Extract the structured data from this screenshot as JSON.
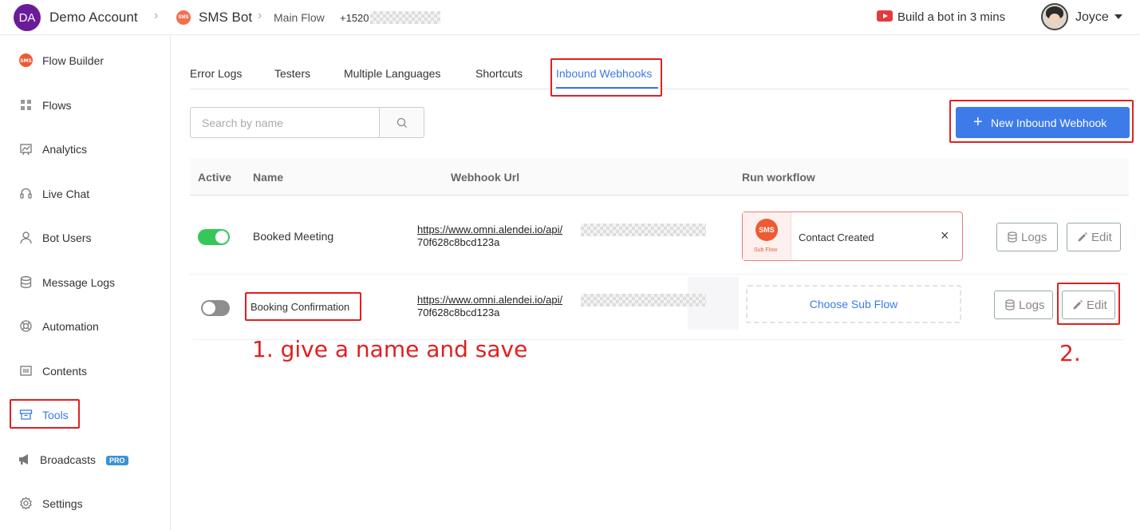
{
  "header": {
    "account_initials": "DA",
    "account_name": "Demo Account",
    "bot_badge": "SMS",
    "bot_name": "SMS Bot",
    "flow_name": "Main Flow",
    "phone_prefix": "+1520",
    "build_label": "Build a bot in 3 mins",
    "user_name": "Joyce"
  },
  "sidebar": {
    "items": [
      {
        "label": "Flow Builder",
        "icon": "sms-icon"
      },
      {
        "label": "Flows",
        "icon": "grid-icon"
      },
      {
        "label": "Analytics",
        "icon": "chart-icon"
      },
      {
        "label": "Live Chat",
        "icon": "headset-icon"
      },
      {
        "label": "Bot Users",
        "icon": "user-icon"
      },
      {
        "label": "Message Logs",
        "icon": "database-icon"
      },
      {
        "label": "Automation",
        "icon": "lifebuoy-icon"
      },
      {
        "label": "Contents",
        "icon": "film-icon"
      },
      {
        "label": "Tools",
        "icon": "archive-icon"
      },
      {
        "label": "Broadcasts",
        "icon": "megaphone-icon",
        "badge": "PRO"
      },
      {
        "label": "Settings",
        "icon": "gear-icon"
      }
    ],
    "active": "Tools"
  },
  "tabs": [
    "Error Logs",
    "Testers",
    "Multiple Languages",
    "Shortcuts",
    "Inbound Webhooks"
  ],
  "active_tab": "Inbound Webhooks",
  "search": {
    "placeholder": "Search by name",
    "value": ""
  },
  "new_button_label": "New Inbound Webhook",
  "table": {
    "headers": [
      "Active",
      "Name",
      "Webhook Url",
      "Run workflow"
    ],
    "rows": [
      {
        "active": true,
        "name": "Booked Meeting",
        "url_line1": "https://www.omni.alendei.io/api/",
        "url_line2": "70f628c8bcd123a",
        "workflow": {
          "badge": "SMS",
          "sub_label": "Sub Flow",
          "title": "Contact Created",
          "close": "×"
        },
        "logs_label": "Logs",
        "edit_label": "Edit"
      },
      {
        "active": false,
        "name": "Booking Confirmation",
        "url_line1": "https://www.omni.alendei.io/api/",
        "url_line2": "70f628c8bcd123a",
        "workflow_placeholder": "Choose Sub Flow",
        "logs_label": "Logs",
        "edit_label": "Edit"
      }
    ]
  },
  "annotations": {
    "step1": "1. give a name and save",
    "step2": "2."
  },
  "colors": {
    "accent": "#3d7be8",
    "toggle_on": "#35c75a",
    "annotation_red": "#e02020",
    "sms_orange": "#ee5a33"
  }
}
